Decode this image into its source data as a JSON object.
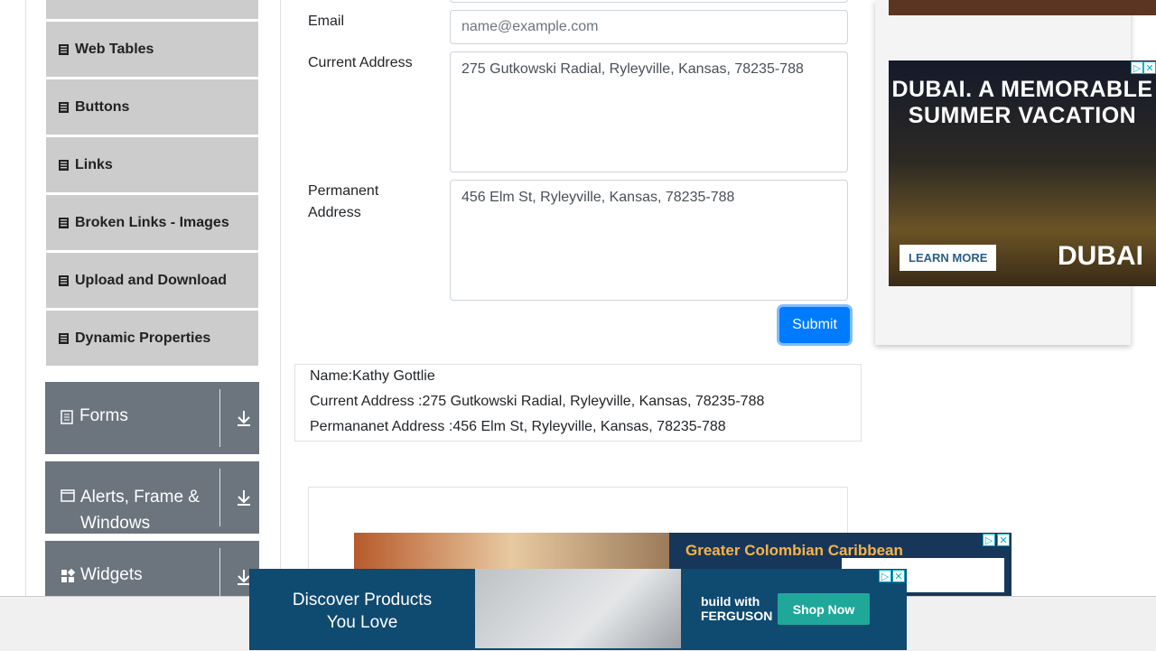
{
  "sidebar": {
    "elements_items": [
      {
        "label": "Web Tables"
      },
      {
        "label": "Buttons"
      },
      {
        "label": "Links"
      },
      {
        "label": "Broken Links - Images"
      },
      {
        "label": "Upload and Download"
      },
      {
        "label": "Dynamic Properties"
      }
    ],
    "groups": [
      {
        "label": "Forms"
      },
      {
        "label": "Alerts, Frame & Windows"
      },
      {
        "label": "Widgets"
      }
    ]
  },
  "form": {
    "email_label": "Email",
    "email_placeholder": "name@example.com",
    "current_address_label": "Current Address",
    "current_address_value": "275 Gutkowski Radial, Ryleyville, Kansas, 78235-788",
    "permanent_address_label": "Permanent Address",
    "permanent_address_value": "456 Elm St, Ryleyville, Kansas, 78235-788",
    "submit_label": "Submit"
  },
  "output": {
    "name": "Name:Kathy Gottlie",
    "current": "Current Address :275 Gutkowski Radial, Ryleyville, Kansas, 78235-788",
    "permanent": "Permananet Address :456 Elm St, Ryleyville, Kansas, 78235-788"
  },
  "ads": {
    "dubai_line1": "DUBAI. A MEMORABLE",
    "dubai_line2": "SUMMER VACATION",
    "dubai_cta": "LEARN MORE",
    "dubai_logo": "DUBAI",
    "colombia_text": "Greater Colombian Caribbean",
    "ferguson_text": "Discover Products You Love",
    "ferguson_brand": "build with FERGUSON",
    "ferguson_cta": "Shop Now"
  }
}
